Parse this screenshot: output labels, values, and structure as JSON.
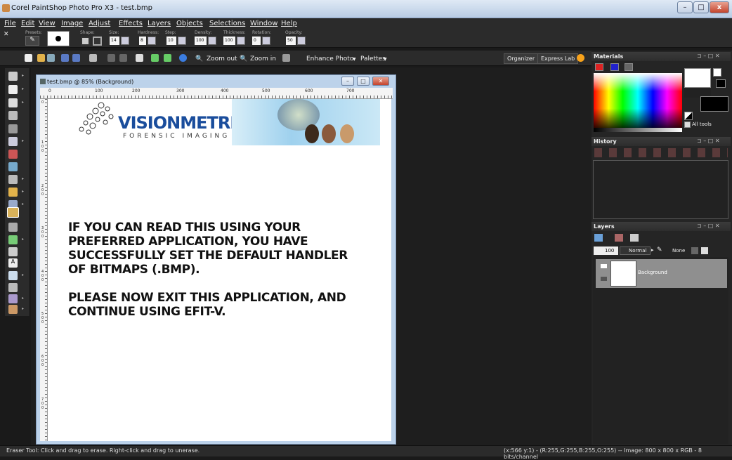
{
  "app": {
    "title": "Corel PaintShop Photo Pro X3 - test.bmp"
  },
  "window_controls": [
    "–",
    "□",
    "x"
  ],
  "menu": [
    "File",
    "Edit",
    "View",
    "Image",
    "Adjust",
    "Effects",
    "Layers",
    "Objects",
    "Selections",
    "Window",
    "Help"
  ],
  "tool_options": {
    "presets_label": "Presets:",
    "shape_label": "Shape:",
    "size_label": "Size:",
    "size_value": "14",
    "hardness_label": "Hardness:",
    "hardness_value": "8",
    "step_label": "Step:",
    "step_value": "10",
    "density_label": "Density:",
    "density_value": "100",
    "thickness_label": "Thickness:",
    "thickness_value": "100",
    "rotation_label": "Rotation:",
    "rotation_value": "0",
    "opacity_label": "Opacity:",
    "opacity_value": "50"
  },
  "toolbar": {
    "zoom_out": "Zoom out",
    "zoom_in": "Zoom in",
    "enhance_photo": "Enhance Photo",
    "palettes": "Palettes",
    "organizer": "Organizer",
    "express_lab": "Express Lab"
  },
  "document": {
    "title": "test.bmp @ 85% (Background)",
    "ruler_h": [
      "0",
      "100",
      "200",
      "300",
      "400",
      "500",
      "600",
      "700"
    ],
    "ruler_v": [
      "0",
      "100",
      "200",
      "300",
      "400",
      "500",
      "600",
      "700"
    ],
    "logo_text": "VISIONMETRIC",
    "logo_subtext": "FORENSIC IMAGING",
    "paragraph1": "IF YOU CAN READ THIS USING YOUR\nPREFERRED APPLICATION, YOU HAVE\nSUCCESSFULLY SET THE DEFAULT HANDLER\nOF BITMAPS (.BMP).",
    "paragraph2": "PLEASE NOW EXIT THIS APPLICATION, AND\nCONTINUE USING EFIT-V."
  },
  "panels": {
    "materials": {
      "title": "Materials",
      "all_tools": "All tools"
    },
    "history": {
      "title": "History"
    },
    "layers": {
      "title": "Layers",
      "opacity": "100",
      "blend_mode": "Normal",
      "mask_label": "None",
      "layer_name": "Background"
    }
  },
  "status": {
    "left": "Eraser Tool: Click and drag to erase. Right-click and drag to unerase.",
    "right": "(x:566 y:1) - (R:255,G:255,B:255,O:255) -- Image: 800 x 800 x RGB - 8 bits/channel"
  },
  "colors": {
    "accent": "#1a4d9c",
    "panel_bg": "#2b2b2b",
    "doc_frame": "#bcd2ea"
  }
}
